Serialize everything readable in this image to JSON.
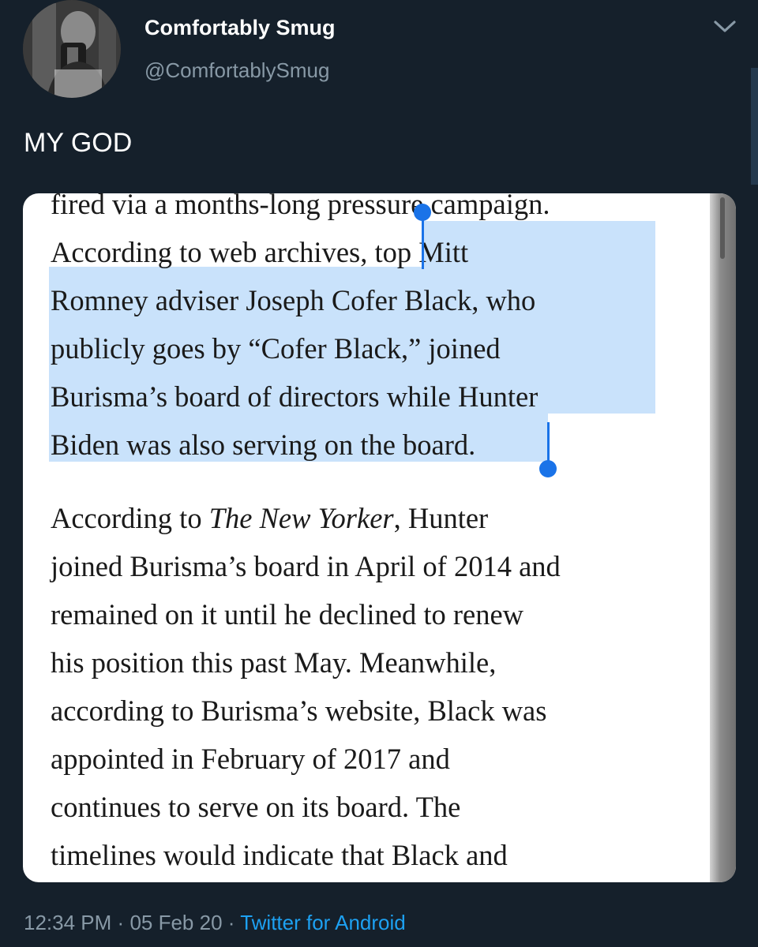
{
  "tweet": {
    "display_name": "Comfortably Smug",
    "handle": "@ComfortablySmug",
    "text": "MY GOD",
    "time": "12:34 PM",
    "date": "05 Feb 20",
    "separator": "·",
    "source": "Twitter for Android"
  },
  "icons": {
    "menu": "chevron-down-icon",
    "avatar": "profile-photo"
  },
  "colors": {
    "background": "#15202b",
    "secondary_text": "#8899a6",
    "link": "#1da1f2",
    "selection": "#c9e2fb",
    "selection_handle": "#1a73e8"
  },
  "screenshot": {
    "lines": [
      "fired via a months-long pressure campaign.",
      "According to web archives, top Mitt",
      "Romney adviser Joseph Cofer Black, who",
      "publicly goes by “Cofer Black,” joined",
      "Burisma’s board of directors while Hunter",
      "Biden was also serving on the board."
    ],
    "p2": {
      "l1_pre": "According to ",
      "l1_italic": "The New Yorker",
      "l1_post": ", Hunter",
      "lines": [
        "joined Burisma’s board in April of 2014 and",
        "remained on it until he declined to renew",
        "his position this past May. Meanwhile,",
        "according to Burisma’s website, Black was",
        "appointed in February of 2017 and",
        "continues to serve on its board. The",
        "timelines would indicate that Black and"
      ]
    }
  }
}
